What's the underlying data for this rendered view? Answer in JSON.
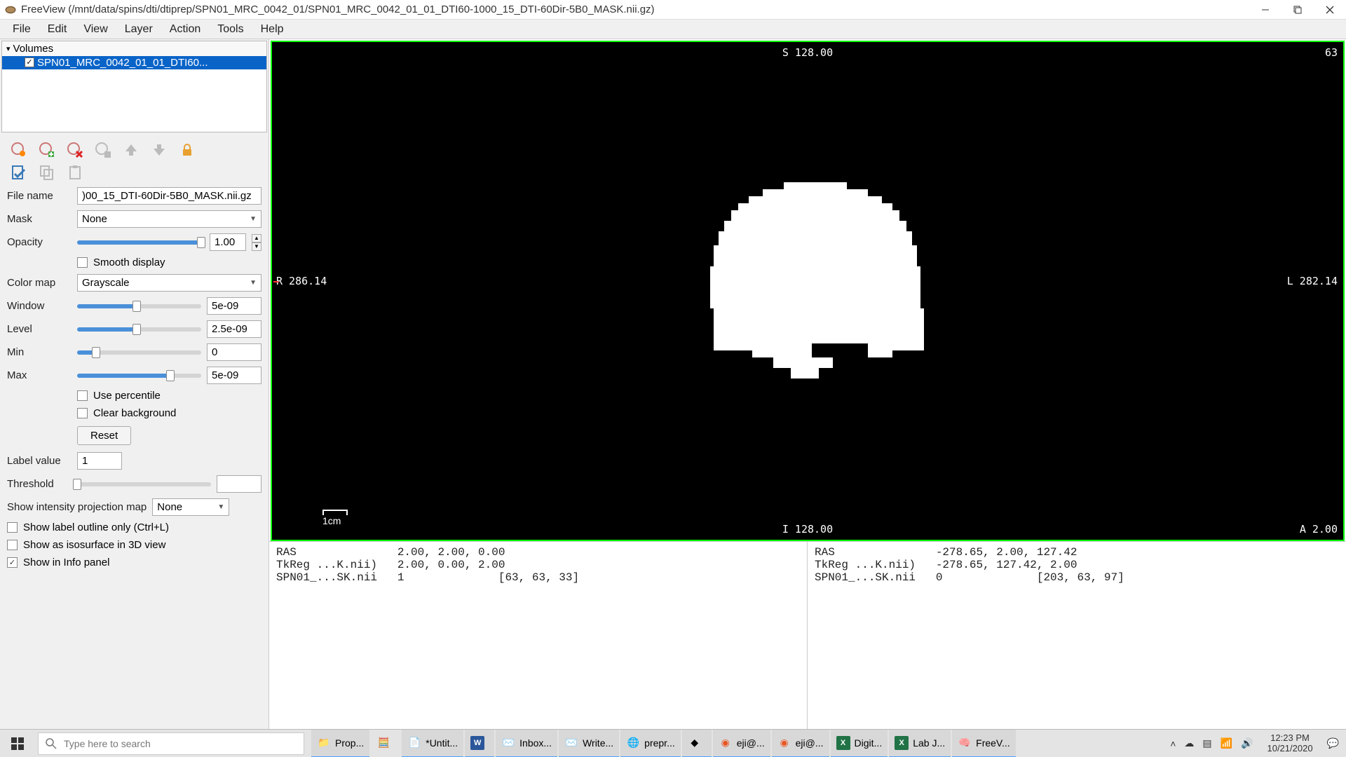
{
  "window": {
    "title": "FreeView (/mnt/data/spins/dti/dtiprep/SPN01_MRC_0042_01/SPN01_MRC_0042_01_01_DTI60-1000_15_DTI-60Dir-5B0_MASK.nii.gz)"
  },
  "menu": {
    "items": [
      "File",
      "Edit",
      "View",
      "Layer",
      "Action",
      "Tools",
      "Help"
    ]
  },
  "volumes": {
    "header": "Volumes",
    "item": "SPN01_MRC_0042_01_01_DTI60..."
  },
  "props": {
    "filename_label": "File name",
    "filename_value": ")00_15_DTI-60Dir-5B0_MASK.nii.gz",
    "mask_label": "Mask",
    "mask_value": "None",
    "opacity_label": "Opacity",
    "opacity_value": "1.00",
    "smooth_label": "Smooth display",
    "colormap_label": "Color map",
    "colormap_value": "Grayscale",
    "window_label": "Window",
    "window_value": "5e-09",
    "level_label": "Level",
    "level_value": "2.5e-09",
    "min_label": "Min",
    "min_value": "0",
    "max_label": "Max",
    "max_value": "5e-09",
    "use_percentile": "Use percentile",
    "clear_bg": "Clear background",
    "reset": "Reset",
    "labelval_label": "Label value",
    "labelval_value": "1",
    "threshold_label": "Threshold",
    "threshold_value": "",
    "proj_label": "Show intensity projection map",
    "proj_value": "None",
    "outline": "Show label outline only (Ctrl+L)",
    "iso": "Show as isosurface in 3D view",
    "infopanel": "Show in Info panel"
  },
  "viewport": {
    "top": "S 128.00",
    "topright": "63",
    "left": "R 286.14",
    "right": "L 282.14",
    "bottom": "I 128.00",
    "bottomright": "A 2.00",
    "scale": "1cm"
  },
  "info_left": "RAS               2.00, 2.00, 0.00\nTkReg ...K.nii)   2.00, 0.00, 2.00\nSPN01_...SK.nii   1              [63, 63, 33]",
  "info_right": "RAS               -278.65, 2.00, 127.42\nTkReg ...K.nii)   -278.65, 127.42, 2.00\nSPN01_...SK.nii   0              [203, 63, 97]",
  "taskbar": {
    "search_placeholder": "Type here to search",
    "apps": [
      {
        "label": "Prop..."
      },
      {
        "label": ""
      },
      {
        "label": "*Untit..."
      },
      {
        "label": ""
      },
      {
        "label": "Inbox..."
      },
      {
        "label": "Write..."
      },
      {
        "label": "prepr..."
      },
      {
        "label": ""
      },
      {
        "label": "eji@..."
      },
      {
        "label": "eji@..."
      },
      {
        "label": "Digit..."
      },
      {
        "label": "Lab J..."
      },
      {
        "label": "FreeV..."
      }
    ],
    "time": "12:23 PM",
    "date": "10/21/2020"
  }
}
